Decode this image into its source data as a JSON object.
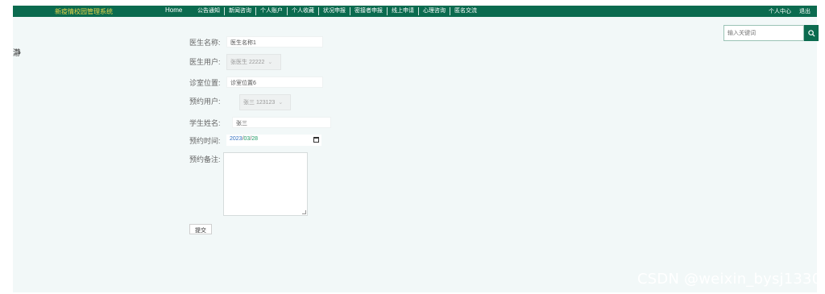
{
  "header": {
    "brand": "新疫情校园管理系统",
    "home": "Home",
    "nav": [
      "公告通知",
      "新闻咨询",
      "个人账户",
      "个人收藏",
      "状况申报",
      "密接者申报",
      "线上申请",
      "心理咨询",
      "匿名交流"
    ],
    "personal_center": "个人中心",
    "logout": "退出"
  },
  "search": {
    "placeholder": "输入关键词",
    "icon": "search-icon"
  },
  "side_text": "瀞",
  "form": {
    "doctor_name": {
      "label": "医生名称:",
      "value": "医生名称1"
    },
    "doctor_user": {
      "label": "医生用户:",
      "value": "张医生 22222"
    },
    "clinic_location": {
      "label": "诊室位置:",
      "value": "诊室位置6"
    },
    "appointment_user": {
      "label": "预约用户:",
      "value": "张三 123123"
    },
    "student_name": {
      "label": "学生姓名:",
      "value": "张三"
    },
    "appointment_time": {
      "label": "预约时间:",
      "year": "2023",
      "month": "03",
      "day": "28",
      "sep": "/"
    },
    "appointment_note": {
      "label": "预约备注:",
      "value": ""
    },
    "submit_label": "提交"
  },
  "watermark": "CSDN @weixin_bysj1330",
  "colors": {
    "header_bg": "#0b6b4f",
    "brand": "#e8d44a",
    "main_bg": "#f2f8f8"
  }
}
